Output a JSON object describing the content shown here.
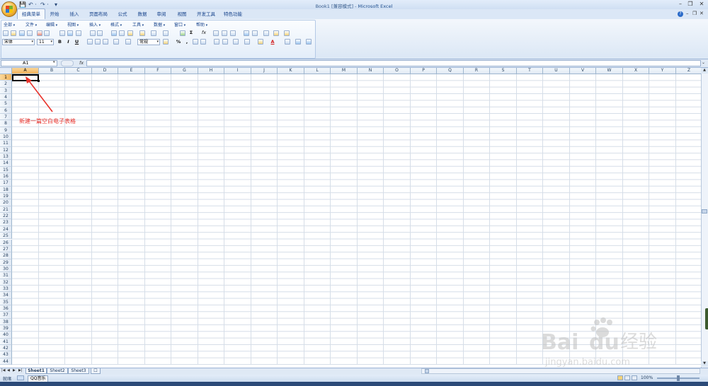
{
  "app": {
    "title": "Book1  [兼容模式] - ",
    "app_name": "Microsoft Excel",
    "qat": {
      "save": "💾",
      "undo": "↶ ·",
      "redo": "↷ ·",
      "more": "▾"
    }
  },
  "window_controls": {
    "minimize": "–",
    "restore": "❐",
    "close": "✕"
  },
  "tabs": [
    "经典菜单",
    "开始",
    "插入",
    "页面布局",
    "公式",
    "数据",
    "审阅",
    "视图",
    "开发工具",
    "特色功能"
  ],
  "classic_menu": [
    "全部",
    "文件",
    "编辑",
    "视图",
    "插入",
    "格式",
    "工具",
    "数据",
    "窗口",
    "帮助"
  ],
  "format_bar": {
    "font": "宋体",
    "size": "11",
    "bold": "B",
    "italic": "I",
    "underline": "U",
    "number_format": "常规",
    "percent": "%",
    "comma": ",",
    "sum": "Σ",
    "fx_btn": "fx",
    "font_color": "A"
  },
  "formula_bar": {
    "name_box": "A1",
    "fx": "fx",
    "value": ""
  },
  "columns": [
    "A",
    "B",
    "C",
    "D",
    "E",
    "F",
    "G",
    "H",
    "I",
    "J",
    "K",
    "L",
    "M",
    "N",
    "O",
    "P",
    "Q",
    "R",
    "S",
    "T",
    "U",
    "V",
    "W",
    "X",
    "Y",
    "Z"
  ],
  "rows": [
    "1",
    "2",
    "3",
    "4",
    "5",
    "6",
    "7",
    "8",
    "9",
    "10",
    "11",
    "12",
    "13",
    "14",
    "15",
    "16",
    "17",
    "18",
    "19",
    "20",
    "21",
    "22",
    "23",
    "24",
    "25",
    "26",
    "27",
    "28",
    "29",
    "30",
    "31",
    "32",
    "33",
    "34",
    "35",
    "36",
    "37",
    "38",
    "39",
    "40",
    "41",
    "42",
    "43",
    "44"
  ],
  "active_cell": "A1",
  "annotation": "新建一篇空白电子表格",
  "sheets": [
    "Sheet1",
    "Sheet2",
    "Sheet3"
  ],
  "sheet_nav": [
    "|◀",
    "◀",
    "▶",
    "▶|"
  ],
  "status": {
    "ready": "就绪",
    "taskbar_item": "QQ音乐",
    "zoom": "100%"
  },
  "watermark": {
    "brand": "Bai",
    "brand2": "du",
    "cn": "经验",
    "url": "jingyan.baidu.com"
  }
}
